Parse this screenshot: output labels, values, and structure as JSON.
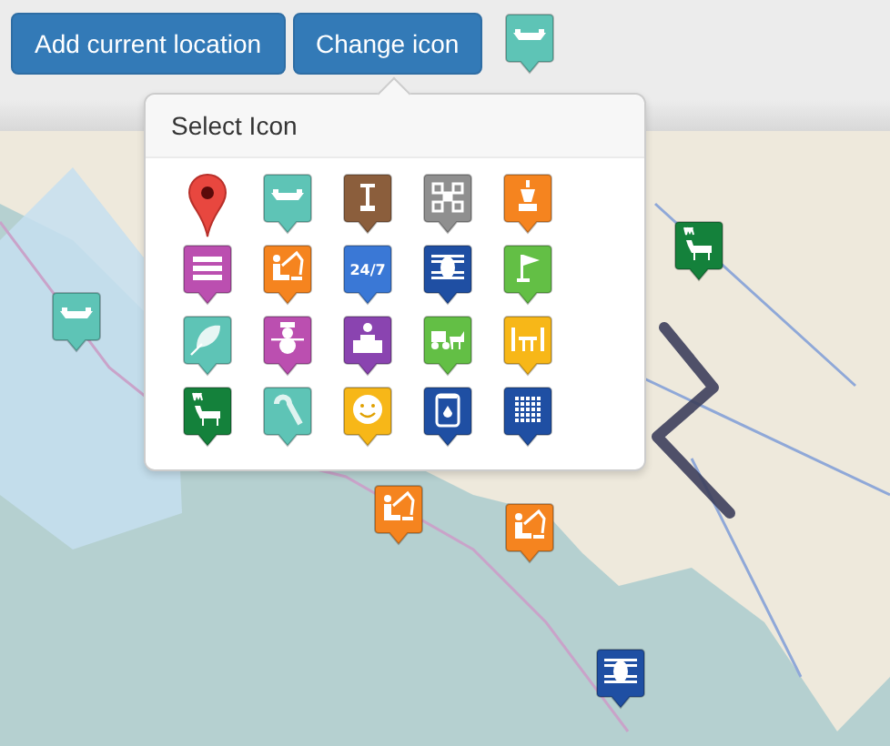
{
  "toolbar": {
    "buttons": [
      "Add current location",
      "Change icon"
    ],
    "current_icon": {
      "kind": "boat",
      "color": "#5ec4b6"
    }
  },
  "popover": {
    "title": "Select Icon",
    "icons": [
      {
        "kind": "pin",
        "color": "#e8473f"
      },
      {
        "kind": "boat",
        "color": "#5ec4b6"
      },
      {
        "kind": "pillar",
        "color": "#8b5e3c"
      },
      {
        "kind": "qr",
        "color": "#8f8f8f"
      },
      {
        "kind": "chess",
        "color": "#f5841f"
      },
      {
        "kind": "lines",
        "color": "#bb4fb0"
      },
      {
        "kind": "fishing",
        "color": "#f5841f"
      },
      {
        "kind": "label",
        "color": "#3a78d6",
        "label": "24/7"
      },
      {
        "kind": "hive",
        "color": "#1f4fa3"
      },
      {
        "kind": "flag",
        "color": "#63bf45"
      },
      {
        "kind": "leaf",
        "color": "#5ec4b6"
      },
      {
        "kind": "snowman",
        "color": "#bb4fb0"
      },
      {
        "kind": "desk",
        "color": "#8a44b0"
      },
      {
        "kind": "carriage",
        "color": "#63bf45"
      },
      {
        "kind": "table",
        "color": "#f7b718"
      },
      {
        "kind": "deer",
        "color": "#14813b"
      },
      {
        "kind": "cane",
        "color": "#5ec4b6"
      },
      {
        "kind": "smiley",
        "color": "#f7b718"
      },
      {
        "kind": "bin",
        "color": "#1f4fa3"
      },
      {
        "kind": "grid",
        "color": "#1f4fa3"
      }
    ]
  },
  "map": {
    "markers": [
      {
        "kind": "boat",
        "color": "#5ec4b6"
      },
      {
        "kind": "deer",
        "color": "#14813b"
      },
      {
        "kind": "fishing",
        "color": "#f5841f"
      },
      {
        "kind": "fishing",
        "color": "#f5841f"
      },
      {
        "kind": "hive",
        "color": "#1f4fa3"
      }
    ]
  }
}
